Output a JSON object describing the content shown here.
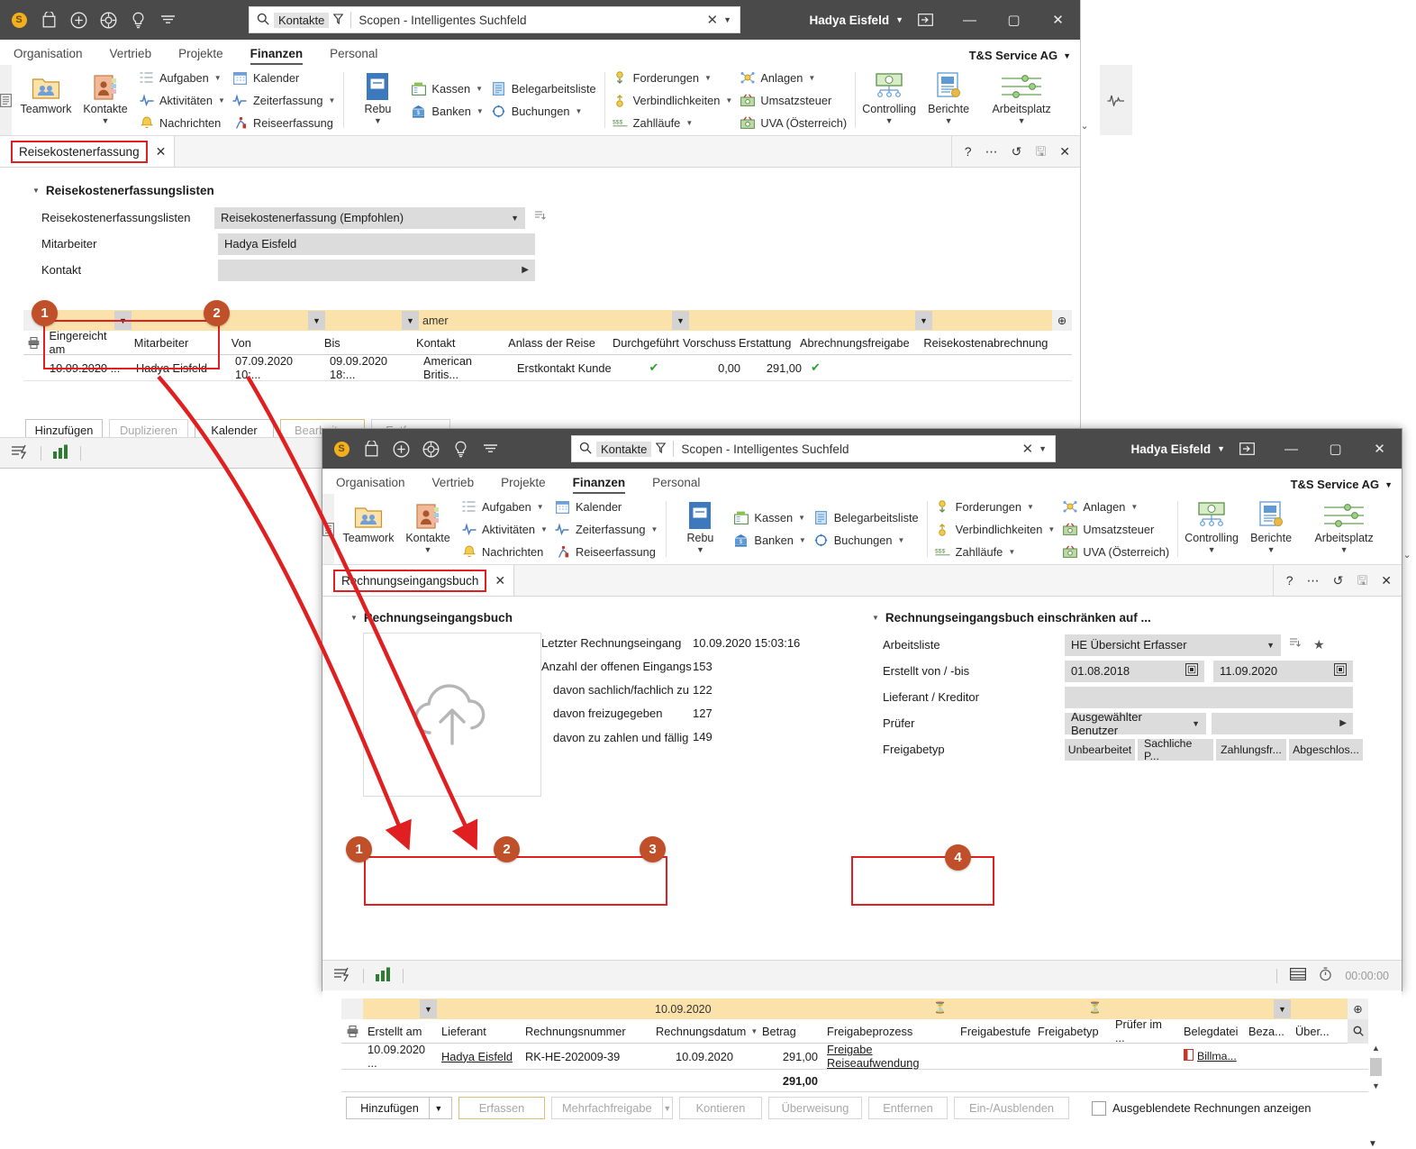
{
  "app": {
    "search_chip": "Kontakte",
    "search_placeholder": "Scopen - Intelligentes Suchfeld",
    "user": "Hadya Eisfeld",
    "company": "T&S Service AG",
    "menu": [
      "Organisation",
      "Vertrieb",
      "Projekte",
      "Finanzen",
      "Personal"
    ],
    "active_menu": "Finanzen",
    "accent_red": "#e02020",
    "callout_color": "#c0502a"
  },
  "ribbon": {
    "big": [
      {
        "label": "Teamwork",
        "icon": "teamwork-icon",
        "dropdown": false
      },
      {
        "label": "Kontakte",
        "icon": "contacts-icon",
        "dropdown": true
      },
      {
        "label": "Rebu",
        "icon": "rebu-icon",
        "dropdown": true
      },
      {
        "label": "Controlling",
        "icon": "controlling-icon",
        "dropdown": true
      },
      {
        "label": "Berichte",
        "icon": "reports-icon",
        "dropdown": true
      },
      {
        "label": "Arbeitsplatz",
        "icon": "workplace-icon",
        "dropdown": true
      }
    ],
    "group_tasks": [
      {
        "label": "Aufgaben",
        "icon": "tasks-icon",
        "dropdown": true
      },
      {
        "label": "Aktivitäten",
        "icon": "activities-icon",
        "dropdown": true
      },
      {
        "label": "Nachrichten",
        "icon": "bell-icon",
        "dropdown": false
      }
    ],
    "group_calendar": [
      {
        "label": "Kalender",
        "icon": "calendar-icon",
        "dropdown": false
      },
      {
        "label": "Zeiterfassung",
        "icon": "time-tracking-icon",
        "dropdown": true
      },
      {
        "label": "Reiseerfassung",
        "icon": "travel-icon",
        "dropdown": false
      }
    ],
    "group_cash": [
      {
        "label": "Kassen",
        "icon": "cash-register-icon",
        "dropdown": true
      },
      {
        "label": "Banken",
        "icon": "bank-icon",
        "dropdown": true
      }
    ],
    "group_docs": [
      {
        "label": "Belegarbeitsliste",
        "icon": "document-list-icon",
        "dropdown": false
      },
      {
        "label": "Buchungen",
        "icon": "bookings-icon",
        "dropdown": true
      }
    ],
    "group_receiv": [
      {
        "label": "Forderungen",
        "icon": "receivables-icon",
        "dropdown": true
      },
      {
        "label": "Verbindlichkeiten",
        "icon": "payables-icon",
        "dropdown": true
      },
      {
        "label": "Zahlläufe",
        "icon": "payment-runs-icon",
        "dropdown": true
      }
    ],
    "group_assets": [
      {
        "label": "Anlagen",
        "icon": "assets-icon",
        "dropdown": true
      },
      {
        "label": "Umsatzsteuer",
        "icon": "vat-icon",
        "dropdown": false
      },
      {
        "label": "UVA (Österreich)",
        "icon": "uva-icon",
        "dropdown": false
      }
    ]
  },
  "window1": {
    "tab": "Reisekostenerfassung",
    "section_title": "Reisekostenerfassungslisten",
    "fields": [
      {
        "label": "Reisekostenerfassungslisten",
        "value": "Reisekostenerfassung (Empfohlen)",
        "type": "dropdown"
      },
      {
        "label": "Mitarbeiter",
        "value": "Hadya Eisfeld",
        "type": "text"
      },
      {
        "label": "Kontakt",
        "value": "",
        "type": "lookup"
      }
    ],
    "grid": {
      "filter_values": [
        "",
        "",
        "",
        "",
        "amer",
        "",
        "",
        "",
        "",
        "",
        ""
      ],
      "columns": [
        "Eingereicht am",
        "Mitarbeiter",
        "Von",
        "Bis",
        "Kontakt",
        "Anlass der Reise",
        "Durchgeführt",
        "Vorschuss",
        "Erstattung",
        "Abrechnungsfreigabe",
        "Reisekostenabrechnung"
      ],
      "rows": [
        {
          "Eingereicht am": "10.09.2020 ...",
          "Mitarbeiter": "Hadya Eisfeld",
          "Von": "07.09.2020 10:...",
          "Bis": "09.09.2020 18:...",
          "Kontakt": "American Britis...",
          "Anlass der Reise": "Erstkontakt Kunde",
          "Durchgeführt": "✔",
          "Vorschuss": "0,00",
          "Erstattung": "291,00",
          "Abrechnungsfreigabe": "✔",
          "Reisekostenabrechnung": ""
        }
      ]
    },
    "buttons": [
      {
        "label": "Hinzufügen",
        "state": "enabled"
      },
      {
        "label": "Duplizieren",
        "state": "disabled"
      },
      {
        "label": "Kalender",
        "state": "enabled"
      },
      {
        "label": "Bearbeiten",
        "state": "gold"
      },
      {
        "label": "Entfernen",
        "state": "disabled"
      }
    ]
  },
  "window2": {
    "tab": "Rechnungseingangsbuch",
    "left_section_title": "Rechnungseingangsbuch",
    "stats": [
      {
        "label": "Letzter Rechnungseingang",
        "value": "10.09.2020 15:03:16",
        "indent": 0
      },
      {
        "label": "Anzahl der offenen Eingangs",
        "value": "153",
        "indent": 0
      },
      {
        "label": "davon sachlich/fachlich zu",
        "value": "122",
        "indent": 1
      },
      {
        "label": "davon freizugegeben",
        "value": "127",
        "indent": 1
      },
      {
        "label": "davon zu zahlen und fällig",
        "value": "149",
        "indent": 1
      }
    ],
    "right_section_title": "Rechnungseingangsbuch einschränken auf ...",
    "filters": [
      {
        "label": "Arbeitsliste",
        "value": "HE Übersicht Erfasser",
        "type": "dropdown"
      },
      {
        "label": "Erstellt von / -bis",
        "value": "01.08.2018",
        "value2": "11.09.2020",
        "type": "daterange"
      },
      {
        "label": "Lieferant / Kreditor",
        "value": "",
        "type": "text"
      },
      {
        "label": "Prüfer",
        "value": "Ausgewählter Benutzer",
        "value2": "",
        "type": "dropdown-lookup"
      }
    ],
    "freigabetyp_label": "Freigabetyp",
    "freigabetyp_options": [
      "Unbearbeitet",
      "Sachliche P...",
      "Zahlungsfr...",
      "Abgeschlos..."
    ],
    "grid": {
      "filter_values": [
        "",
        "",
        "",
        "10.09.2020",
        "",
        "",
        "",
        "",
        "",
        "",
        "",
        ""
      ],
      "columns": [
        "Erstellt am",
        "Lieferant",
        "Rechnungsnummer",
        "Rechnungsdatum",
        "Betrag",
        "Freigabeprozess",
        "Freigabestufe",
        "Freigabetyp",
        "Prüfer im ...",
        "Belegdatei",
        "Beza...",
        "Über..."
      ],
      "rows": [
        {
          "Erstellt am": "10.09.2020 ...",
          "Lieferant": "Hadya Eisfeld",
          "Rechnungsnummer": "RK-HE-202009-39",
          "Rechnungsdatum": "10.09.2020",
          "Betrag": "291,00",
          "Freigabeprozess": "Freigabe Reiseaufwendung",
          "Freigabestufe": "",
          "Freigabetyp": "",
          "Prüfer im ...": "",
          "Belegdatei": "Billma...",
          "Beza...": "€",
          "Über...": ""
        }
      ],
      "total": "291,00"
    },
    "buttons": [
      {
        "label": "Hinzufügen",
        "state": "enabled",
        "split": true
      },
      {
        "label": "Erfassen",
        "state": "gold"
      },
      {
        "label": "Mehrfachfreigabe",
        "state": "disabled",
        "split": true
      },
      {
        "label": "Kontieren",
        "state": "disabled"
      },
      {
        "label": "Überweisung",
        "state": "disabled"
      },
      {
        "label": "Entfernen",
        "state": "disabled"
      },
      {
        "label": "Ein-/Ausblenden",
        "state": "disabled"
      }
    ],
    "checkbox_label": "Ausgeblendete Rechnungen anzeigen",
    "checkbox_checked": false,
    "status_timer": "00:00:00"
  },
  "callouts": [
    {
      "n": "1",
      "target": "window1-eingereicht-am-column"
    },
    {
      "n": "2",
      "target": "window1-mitarbeiter-column"
    },
    {
      "n": "1",
      "target": "window2-erstellt-am-column"
    },
    {
      "n": "2",
      "target": "window2-lieferant-column"
    },
    {
      "n": "3",
      "target": "window2-rechnungsnummer-column"
    },
    {
      "n": "4",
      "target": "window2-freigabeprozess-column"
    }
  ]
}
